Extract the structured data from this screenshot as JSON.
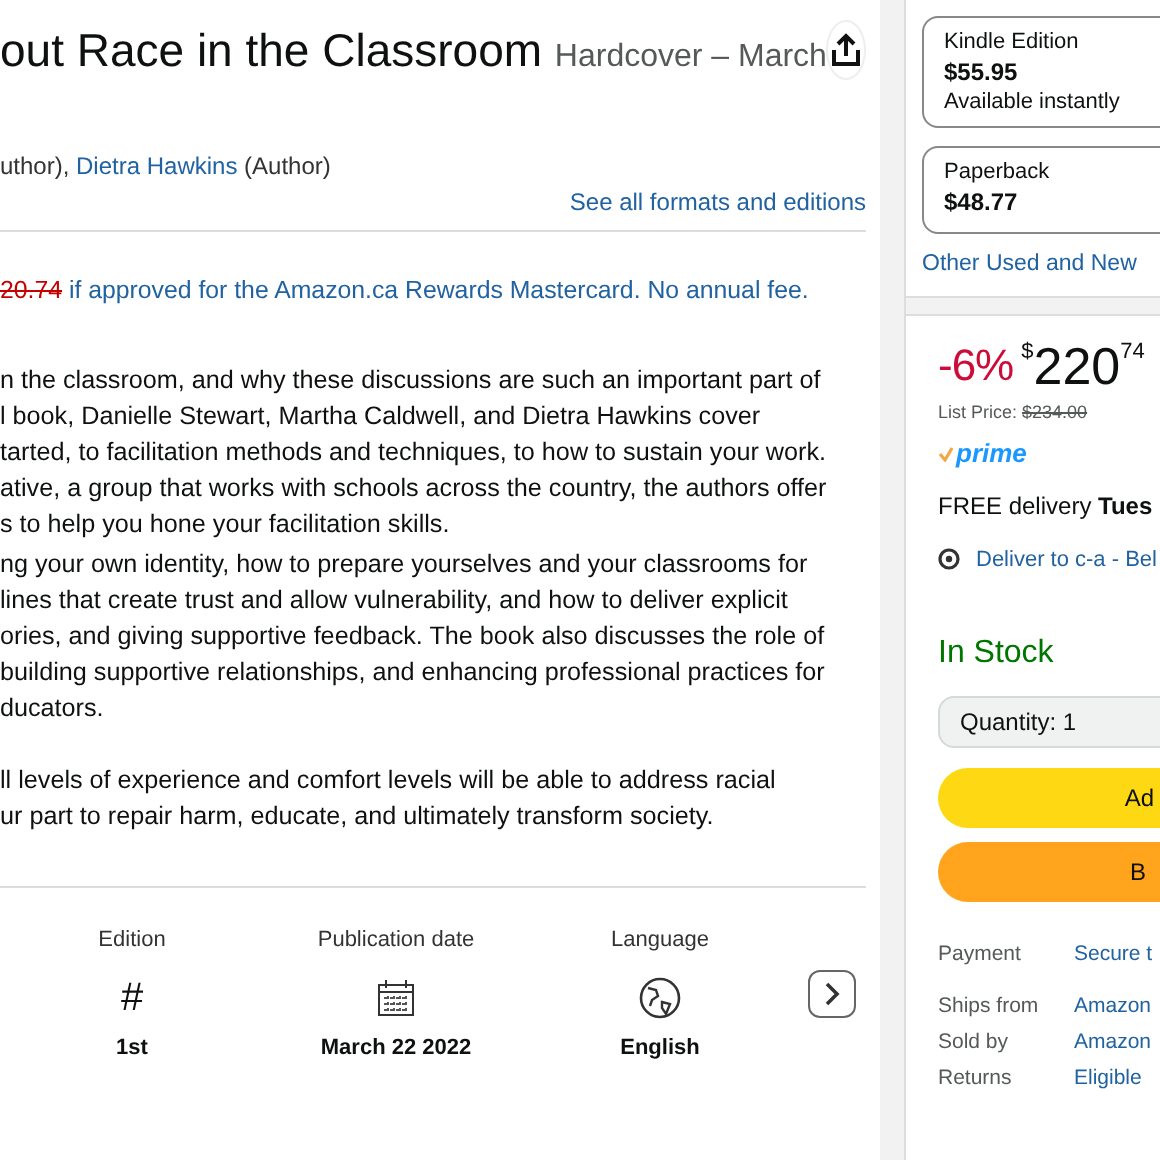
{
  "header": {
    "title": "out Race in the Classroom",
    "format": "Hardcover – March",
    "authors_tail": "uthor), ",
    "author": "Dietra Hawkins",
    "author_role": " (Author)",
    "formats_link": "See all formats and editions"
  },
  "offer": {
    "old_price": "20.74",
    "text": " if approved for the Amazon.ca Rewards Mastercard. No annual fee."
  },
  "description": [
    [
      "n the classroom, and why these discussions are such an important part of",
      "l book, Danielle Stewart, Martha Caldwell, and Dietra Hawkins cover",
      "tarted, to facilitation methods and techniques, to how to sustain your work.",
      "ative, a group that works with schools across the country, the authors offer",
      "s to help you hone your facilitation skills."
    ],
    [
      "ng your own identity, how to prepare yourselves and your classrooms for",
      "lines that create trust and allow vulnerability, and how to deliver explicit",
      "ories, and giving supportive feedback. The book also discusses the role of",
      "building supportive relationships, and enhancing professional practices for",
      "ducators."
    ],
    [
      "ll levels of experience and comfort levels will be able to address racial",
      "ur part to repair harm, educate, and ultimately transform society."
    ]
  ],
  "details": [
    {
      "label": "Edition",
      "kind": "hash",
      "icon_text": "#",
      "value": "1st"
    },
    {
      "label": "Publication date",
      "kind": "calendar",
      "value": "March 22 2022"
    },
    {
      "label": "Language",
      "kind": "globe",
      "value": "English"
    }
  ],
  "formats": [
    {
      "name": "Kindle Edition",
      "price": "$55.95",
      "note": "Available instantly"
    },
    {
      "name": "Paperback",
      "price": "$48.77"
    }
  ],
  "other_link": "Other Used and New",
  "buybox": {
    "discount": "-6%",
    "currency": "$",
    "price_whole": "220",
    "price_fraction": "74",
    "list_price_label": "List Price: ",
    "list_price": "$234.00",
    "prime": "prime",
    "delivery_prefix": "FREE delivery ",
    "delivery_day": "Tues",
    "deliver_to": "Deliver to c-a - Bel",
    "stock": "In Stock",
    "quantity": "Quantity: 1",
    "add_button": "Ad",
    "buy_button": "B",
    "info": [
      {
        "label": "Payment",
        "value": "Secure t"
      },
      {
        "label": "Ships from",
        "value": "Amazon"
      },
      {
        "label": "Sold by",
        "value": "Amazon"
      },
      {
        "label": "Returns",
        "value": "Eligible"
      }
    ]
  }
}
